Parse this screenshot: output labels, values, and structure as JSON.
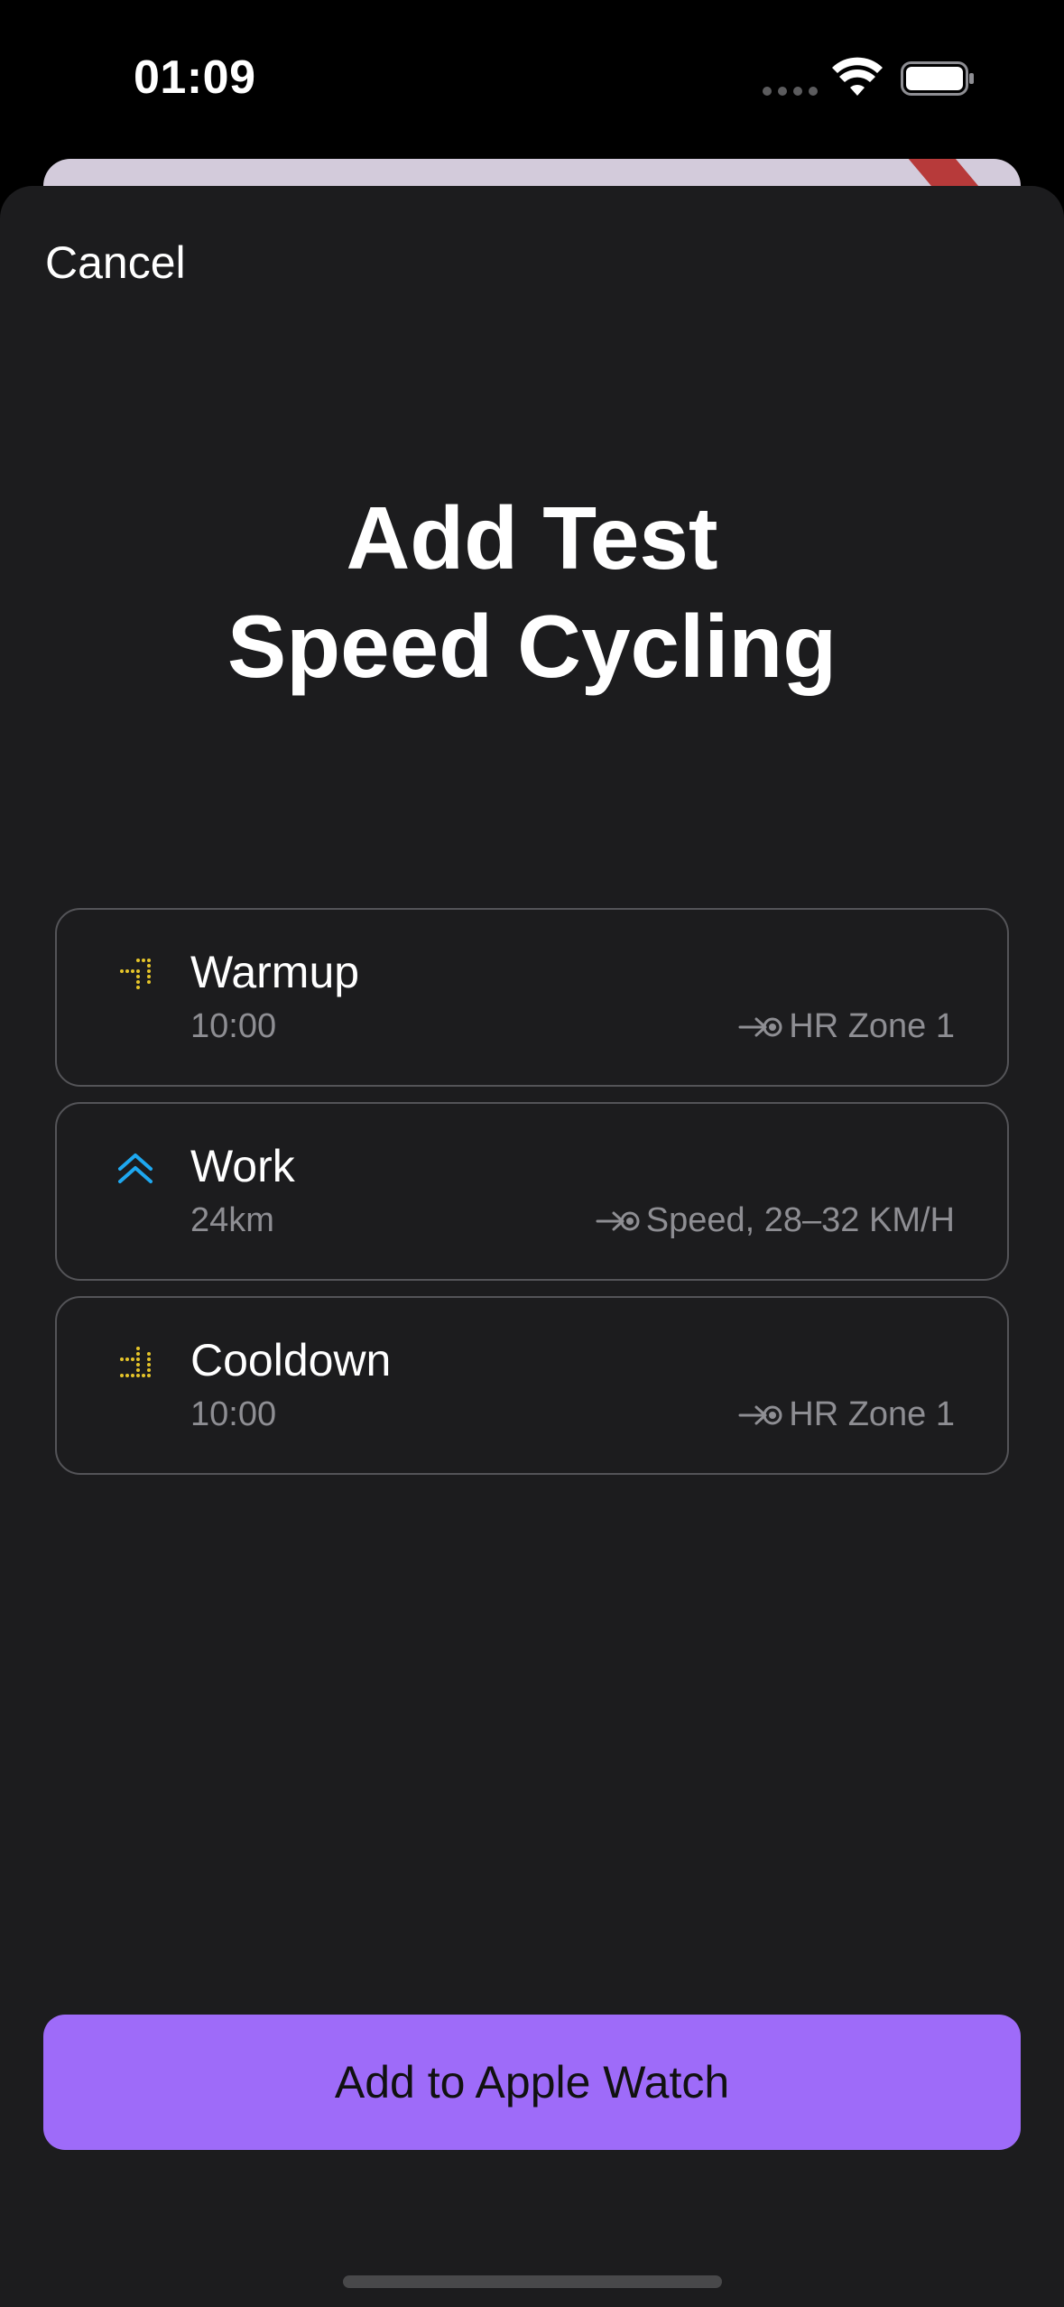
{
  "status_bar": {
    "time": "01:09"
  },
  "sheet": {
    "cancel_label": "Cancel",
    "title_line1": "Add Test",
    "title_line2": "Speed Cycling",
    "steps": [
      {
        "name": "Warmup",
        "value": "10:00",
        "target": "HR Zone 1",
        "icon": "warmup-icon",
        "icon_color": "#e5c42a"
      },
      {
        "name": "Work",
        "value": "24km",
        "target": "Speed, 28–32 KM/H",
        "icon": "work-icon",
        "icon_color": "#1ea8f0"
      },
      {
        "name": "Cooldown",
        "value": "10:00",
        "target": "HR Zone 1",
        "icon": "cooldown-icon",
        "icon_color": "#e5c42a"
      }
    ],
    "primary_button_label": "Add to Apple Watch"
  },
  "colors": {
    "background": "#000000",
    "sheet": "#1c1c1e",
    "card_border": "#545458",
    "secondary_text": "#8e8e93",
    "accent": "#9e6bf9"
  }
}
